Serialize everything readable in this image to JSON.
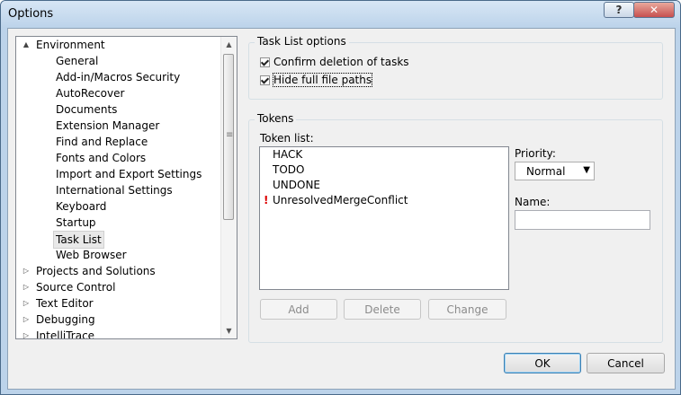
{
  "window": {
    "title": "Options"
  },
  "titlebar_buttons": {
    "help": "?",
    "close": "✕"
  },
  "tree": {
    "items": [
      {
        "label": "Environment",
        "expander": "▲",
        "level": 0
      },
      {
        "label": "General",
        "level": 1
      },
      {
        "label": "Add-in/Macros Security",
        "level": 1
      },
      {
        "label": "AutoRecover",
        "level": 1
      },
      {
        "label": "Documents",
        "level": 1
      },
      {
        "label": "Extension Manager",
        "level": 1
      },
      {
        "label": "Find and Replace",
        "level": 1
      },
      {
        "label": "Fonts and Colors",
        "level": 1
      },
      {
        "label": "Import and Export Settings",
        "level": 1
      },
      {
        "label": "International Settings",
        "level": 1
      },
      {
        "label": "Keyboard",
        "level": 1
      },
      {
        "label": "Startup",
        "level": 1
      },
      {
        "label": "Task List",
        "level": 1,
        "selected": true
      },
      {
        "label": "Web Browser",
        "level": 1
      },
      {
        "label": "Projects and Solutions",
        "expander": "▷",
        "level": 0
      },
      {
        "label": "Source Control",
        "expander": "▷",
        "level": 0
      },
      {
        "label": "Text Editor",
        "expander": "▷",
        "level": 0
      },
      {
        "label": "Debugging",
        "expander": "▷",
        "level": 0
      },
      {
        "label": "IntelliTrace",
        "expander": "▷",
        "level": 0
      }
    ]
  },
  "task_list_options": {
    "title": "Task List options",
    "confirm_deletion": {
      "label": "Confirm deletion of tasks",
      "checked": true
    },
    "hide_full_paths": {
      "label": "Hide full file paths",
      "checked": true
    }
  },
  "tokens": {
    "title": "Tokens",
    "token_list_label": "Token list:",
    "items": [
      {
        "label": "HACK",
        "warning": false
      },
      {
        "label": "TODO",
        "warning": false
      },
      {
        "label": "UNDONE",
        "warning": false
      },
      {
        "label": "UnresolvedMergeConflict",
        "warning": true
      }
    ],
    "priority_label": "Priority:",
    "priority_value": "Normal",
    "name_label": "Name:",
    "name_value": "",
    "add_label": "Add",
    "delete_label": "Delete",
    "change_label": "Change"
  },
  "footer": {
    "ok_label": "OK",
    "cancel_label": "Cancel"
  },
  "colors": {
    "accent": "#3c7fb1",
    "warning": "#dd0000",
    "frame": "#bcd3ea"
  }
}
